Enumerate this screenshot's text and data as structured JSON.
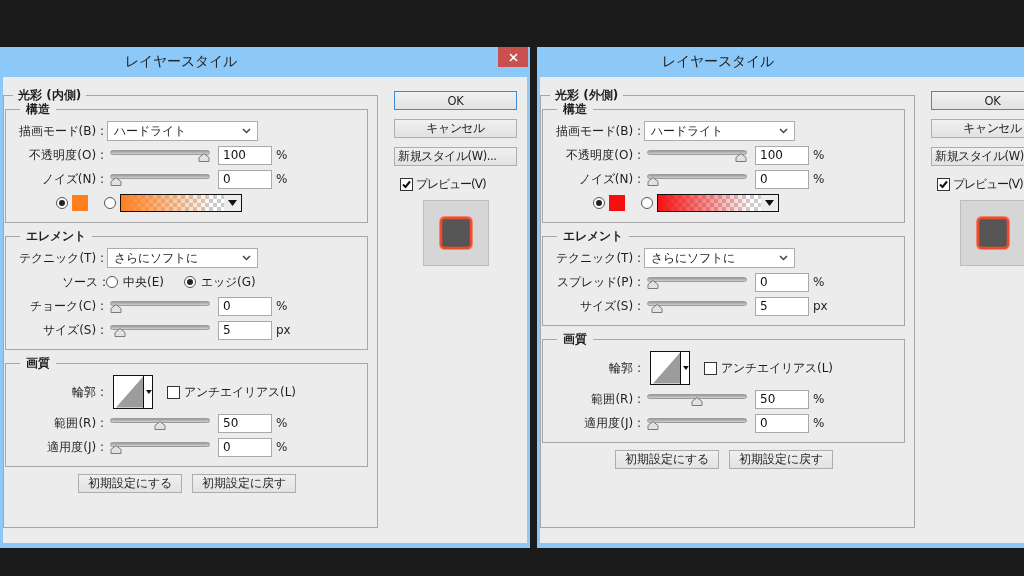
{
  "dialogs": [
    {
      "title": "レイヤースタイル",
      "title_buttons": [
        {
          "kind": "close"
        }
      ],
      "effect_title": "光彩 (内側)",
      "sections": [
        {
          "title": "構造",
          "rows": [
            {
              "kind": "dropdown",
              "label": "描画モード(B) :",
              "value": "ハードライト"
            },
            {
              "kind": "slider",
              "label": "不透明度(O) :",
              "level": 1,
              "value": "100",
              "unit": "%"
            },
            {
              "kind": "slider",
              "label": "ノイズ(N) :",
              "level": 0,
              "value": "0",
              "unit": "%"
            },
            {
              "kind": "color",
              "color": "#ff7f1e",
              "options": [
                {
                  "selected": true
                },
                {
                  "selected": false
                }
              ]
            }
          ]
        },
        {
          "title": "エレメント",
          "rows": [
            {
              "kind": "dropdown",
              "label": "テクニック(T) :",
              "value": "さらにソフトに"
            },
            {
              "kind": "radio",
              "label": "ソース :",
              "options": [
                {
                  "label": "中央(E)",
                  "selected": false
                },
                {
                  "label": "エッジ(G)",
                  "selected": true
                }
              ]
            },
            {
              "kind": "slider",
              "label": "チョーク(C) :",
              "level": 0,
              "value": "0",
              "unit": "%"
            },
            {
              "kind": "slider",
              "label": "サイズ(S) :",
              "level": 0.05,
              "value": "5",
              "unit": "px"
            }
          ]
        },
        {
          "title": "画質",
          "rows": [
            {
              "kind": "contour",
              "label": "輪郭 :",
              "checkbox": {
                "label": "アンチエイリアス(L)",
                "checked": false
              }
            },
            {
              "kind": "slider",
              "label": "範囲(R) :",
              "level": 0.5,
              "value": "50",
              "unit": "%"
            },
            {
              "kind": "slider",
              "label": "適用度(J) :",
              "level": 0,
              "value": "0",
              "unit": "%"
            }
          ]
        }
      ],
      "reset_buttons": [
        "初期設定にする",
        "初期設定に戻す"
      ],
      "side_buttons": [
        {
          "label": "OK",
          "default": true
        },
        {
          "label": "キャンセル",
          "default": false
        },
        {
          "label": "新規スタイル(W)...",
          "default": false
        }
      ],
      "preview": {
        "label": "プレビュー(V)",
        "checked": true
      }
    },
    {
      "title": "レイヤースタイル",
      "effect_title": "光彩 (外側)",
      "sections": [
        {
          "title": "構造",
          "rows": [
            {
              "kind": "dropdown",
              "label": "描画モード(B) :",
              "value": "ハードライト"
            },
            {
              "kind": "slider",
              "label": "不透明度(O) :",
              "level": 1,
              "value": "100",
              "unit": "%"
            },
            {
              "kind": "slider",
              "label": "ノイズ(N) :",
              "level": 0,
              "value": "0",
              "unit": "%"
            },
            {
              "kind": "color",
              "color": "#f51010",
              "options": [
                {
                  "selected": true
                },
                {
                  "selected": false
                }
              ]
            }
          ]
        },
        {
          "title": "エレメント",
          "rows": [
            {
              "kind": "dropdown",
              "label": "テクニック(T) :",
              "value": "さらにソフトに"
            },
            {
              "kind": "slider",
              "label": "スプレッド(P) :",
              "level": 0,
              "value": "0",
              "unit": "%"
            },
            {
              "kind": "slider",
              "label": "サイズ(S) :",
              "level": 0.05,
              "value": "5",
              "unit": "px"
            }
          ]
        },
        {
          "title": "画質",
          "rows": [
            {
              "kind": "contour",
              "label": "輪郭 :",
              "checkbox": {
                "label": "アンチエイリアス(L)",
                "checked": false
              }
            },
            {
              "kind": "slider",
              "label": "範囲(R) :",
              "level": 0.5,
              "value": "50",
              "unit": "%"
            },
            {
              "kind": "slider",
              "label": "適用度(J) :",
              "level": 0,
              "value": "0",
              "unit": "%"
            }
          ]
        }
      ],
      "reset_buttons": [
        "初期設定にする",
        "初期設定に戻す"
      ],
      "side_buttons": [
        {
          "label": "OK",
          "default": true
        },
        {
          "label": "キャンセル",
          "default": false
        },
        {
          "label": "新規スタイル(W)",
          "default": false
        }
      ],
      "preview": {
        "label": "プレビュー(V)",
        "checked": true
      }
    }
  ]
}
